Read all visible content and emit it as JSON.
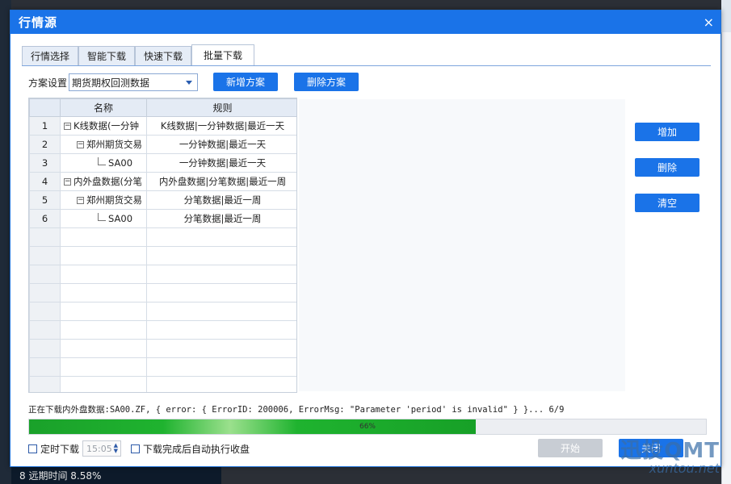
{
  "window": {
    "title": "行情源",
    "close_icon": "×"
  },
  "tabs": [
    {
      "label": "行情选择"
    },
    {
      "label": "智能下载"
    },
    {
      "label": "快速下载"
    },
    {
      "label": "批量下载"
    }
  ],
  "plan": {
    "label": "方案设置",
    "selected": "期货期权回测数据",
    "add_label": "新增方案",
    "delete_label": "删除方案"
  },
  "grid": {
    "headers": {
      "num": "",
      "name": "名称",
      "rule": "规则"
    },
    "rows": [
      {
        "num": "1",
        "name": "K线数据(一分钟",
        "rule": "K线数据|一分钟数据|最近一天"
      },
      {
        "num": "2",
        "name": "郑州期货交易",
        "rule": "一分钟数据|最近一天"
      },
      {
        "num": "3",
        "name": "SA00",
        "rule": "一分钟数据|最近一天"
      },
      {
        "num": "4",
        "name": "内外盘数据(分笔",
        "rule": "内外盘数据|分笔数据|最近一周"
      },
      {
        "num": "5",
        "name": "郑州期货交易",
        "rule": "分笔数据|最近一周"
      },
      {
        "num": "6",
        "name": "SA00",
        "rule": "分笔数据|最近一周"
      }
    ]
  },
  "side_buttons": {
    "add": "增加",
    "delete": "删除",
    "clear": "清空"
  },
  "status_text": "正在下载内外盘数据:SA00.ZF, { error: { ErrorID: 200006, ErrorMsg: \"Parameter 'period' is invalid\" } }... 6/9",
  "progress": {
    "percent": 66,
    "label": "66%"
  },
  "bottom": {
    "timer_label": "定时下载",
    "time_value": "15:05",
    "auto_label": "下载完成后自动执行收盘",
    "start_label": "开始",
    "close_label": "关闭"
  },
  "background": {
    "bottom_text": "8   远期时间   8.58%"
  },
  "watermark": {
    "brand": "迅投QMT",
    "site": "xuntou.net"
  },
  "colors": {
    "accent": "#1a73e8",
    "progress": "#1fb32f"
  }
}
